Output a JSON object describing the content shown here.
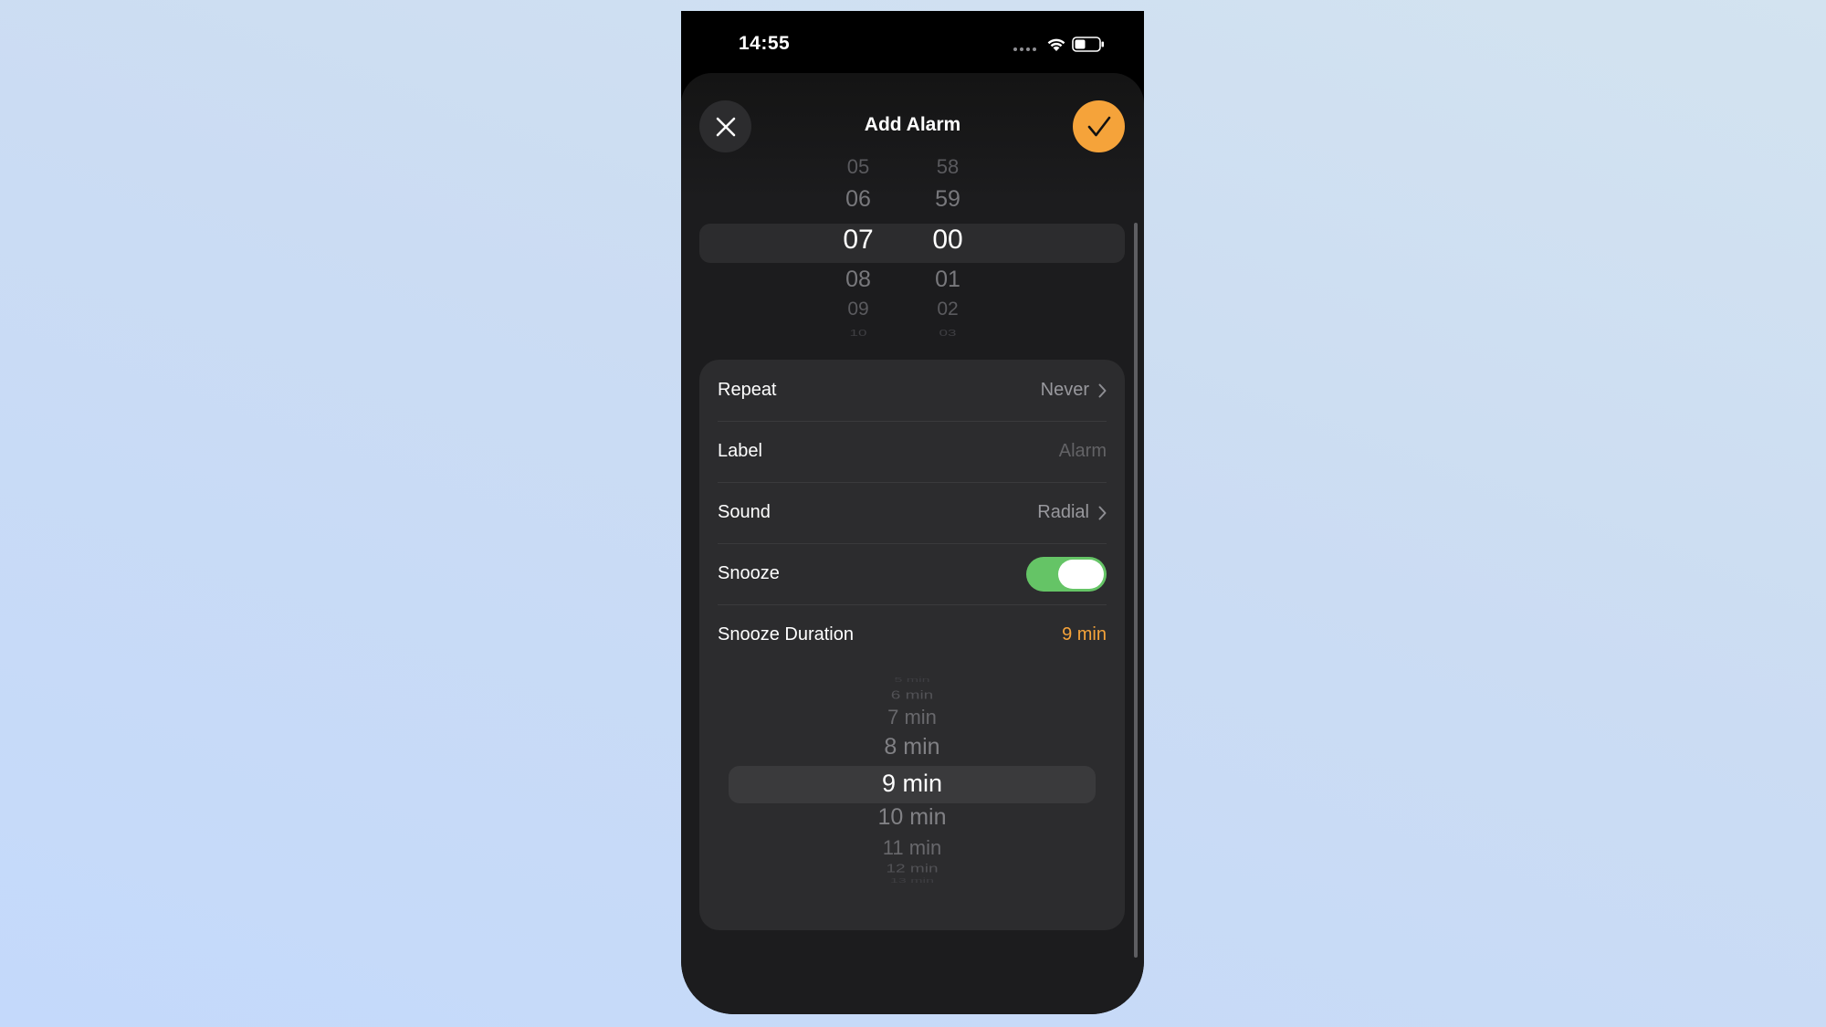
{
  "status_bar": {
    "time": "14:55"
  },
  "header": {
    "title": "Add Alarm",
    "close_icon": "close-icon",
    "confirm_icon": "checkmark-icon",
    "accent_color": "#f5a33a"
  },
  "time_picker": {
    "hours": [
      "05",
      "06",
      "07",
      "08",
      "09",
      "10"
    ],
    "minutes": [
      "58",
      "59",
      "00",
      "01",
      "02",
      "03"
    ],
    "selected_hour": "07",
    "selected_minute": "00"
  },
  "settings": {
    "repeat": {
      "label": "Repeat",
      "value": "Never"
    },
    "label": {
      "label": "Label",
      "placeholder": "Alarm"
    },
    "sound": {
      "label": "Sound",
      "value": "Radial"
    },
    "snooze": {
      "label": "Snooze",
      "on": true,
      "color": "#65c466"
    },
    "snooze_duration": {
      "label": "Snooze Duration",
      "value": "9 min"
    }
  },
  "snooze_picker": {
    "options": [
      "5 min",
      "6 min",
      "7 min",
      "8 min",
      "9 min",
      "10 min",
      "11 min",
      "12 min",
      "13 min"
    ],
    "selected": "9 min"
  }
}
